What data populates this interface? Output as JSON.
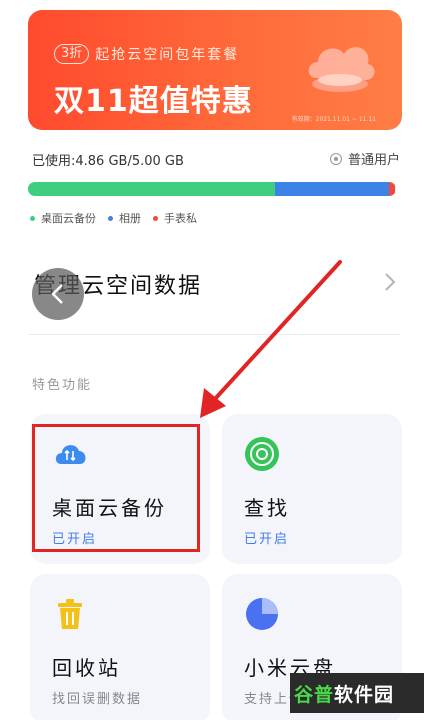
{
  "banner": {
    "pill": "3折",
    "tagline": "起抢云空间包年套餐",
    "title": "双11超值特惠",
    "fine_print": "有效期：2021.11.01 ~ 11.11",
    "bg_color": "#ff5a34"
  },
  "usage": {
    "text": "已使用:4.86 GB/5.00 GB",
    "user_type": "普通用户",
    "segments": [
      {
        "name": "桌面云备份",
        "fraction": 0.67,
        "color": "#3ecf7e"
      },
      {
        "name": "相册",
        "fraction": 0.31,
        "color": "#3c83e8"
      },
      {
        "name": "手表私",
        "fraction": 0.016,
        "color": "#ef4a3c"
      }
    ]
  },
  "manage": {
    "label": "管理云空间数据"
  },
  "features": {
    "section_label": "特色功能",
    "cards": [
      {
        "title": "桌面云备份",
        "subtitle": "已开启",
        "icon": "cloud-sync-icon",
        "color": "#3c8cf0"
      },
      {
        "title": "查找",
        "subtitle": "已开启",
        "icon": "radar-target-icon",
        "color": "#35c45a"
      },
      {
        "title": "回收站",
        "subtitle": "找回误删数据",
        "icon": "trash-icon",
        "color": "#f5c117"
      },
      {
        "title": "小米云盘",
        "subtitle": "支持上传...",
        "icon": "pie-chart-icon",
        "color": "#4a72f0"
      }
    ]
  },
  "watermark": {
    "prefix": "谷普",
    "suffix": "软件园"
  }
}
